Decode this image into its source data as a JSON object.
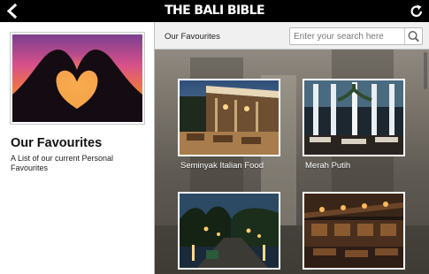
{
  "app": {
    "brand": "THE BALI BIBLE"
  },
  "icons": {
    "back": "chevron-left-icon",
    "refresh": "refresh-icon",
    "search": "search-icon"
  },
  "left_panel": {
    "title": "Our Favourites",
    "description": "A List of our current Personal Favourites"
  },
  "subheader": {
    "title": "Our Favourites",
    "search_placeholder": "Enter your search here"
  },
  "cards": [
    {
      "label": "Seminyak Italian Food"
    },
    {
      "label": "Merah Putih"
    },
    {
      "label": ""
    },
    {
      "label": ""
    }
  ],
  "colors": {
    "topbar": "#000000",
    "panel_bg": "#ffffff",
    "text_dark": "#111111",
    "sunset_orange": "#f08a3a",
    "sunset_pink": "#e0568a"
  }
}
